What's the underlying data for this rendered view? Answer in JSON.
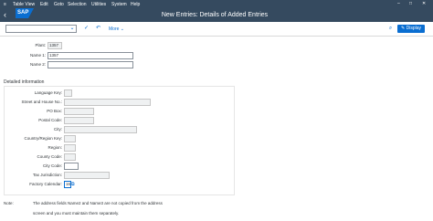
{
  "menu": {
    "items": [
      "Table View",
      "Edit",
      "Goto",
      "Selection",
      "Utilities",
      "System",
      "Help"
    ]
  },
  "window": {
    "title": "New Entries: Details of Added Entries",
    "logo_text": "SAP",
    "controls": [
      "–",
      "□",
      "✕"
    ]
  },
  "toolbar": {
    "more_label": "More",
    "display_label": "Display"
  },
  "form": {
    "plant_label": "Plant:",
    "plant_value": "1357",
    "name1_label": "Name 1:",
    "name1_value": "1357",
    "name2_label": "Name 2:",
    "name2_value": ""
  },
  "detail": {
    "section_title": "Detailed information",
    "language_key_label": "Language Key:",
    "street_label": "Street and House No.:",
    "po_box_label": "PO Box:",
    "postal_code_label": "Postal Code:",
    "city_label": "City:",
    "country_label": "Country/Region Key:",
    "region_label": "Region:",
    "county_code_label": "County Code:",
    "city_code_label": "City Code:",
    "tax_jurisdiction_label": "Tax Jurisdiction:",
    "factory_calendar_label": "Factory Calendar:",
    "factory_calendar_value": "16"
  },
  "note": {
    "label": "Note:",
    "line1": "The address fields Name2 and Name3 are not copied from the address",
    "line2": "screen and you must maintain them separately."
  },
  "colors": {
    "shell": "#354a5f",
    "accent": "#0a6ed1"
  }
}
